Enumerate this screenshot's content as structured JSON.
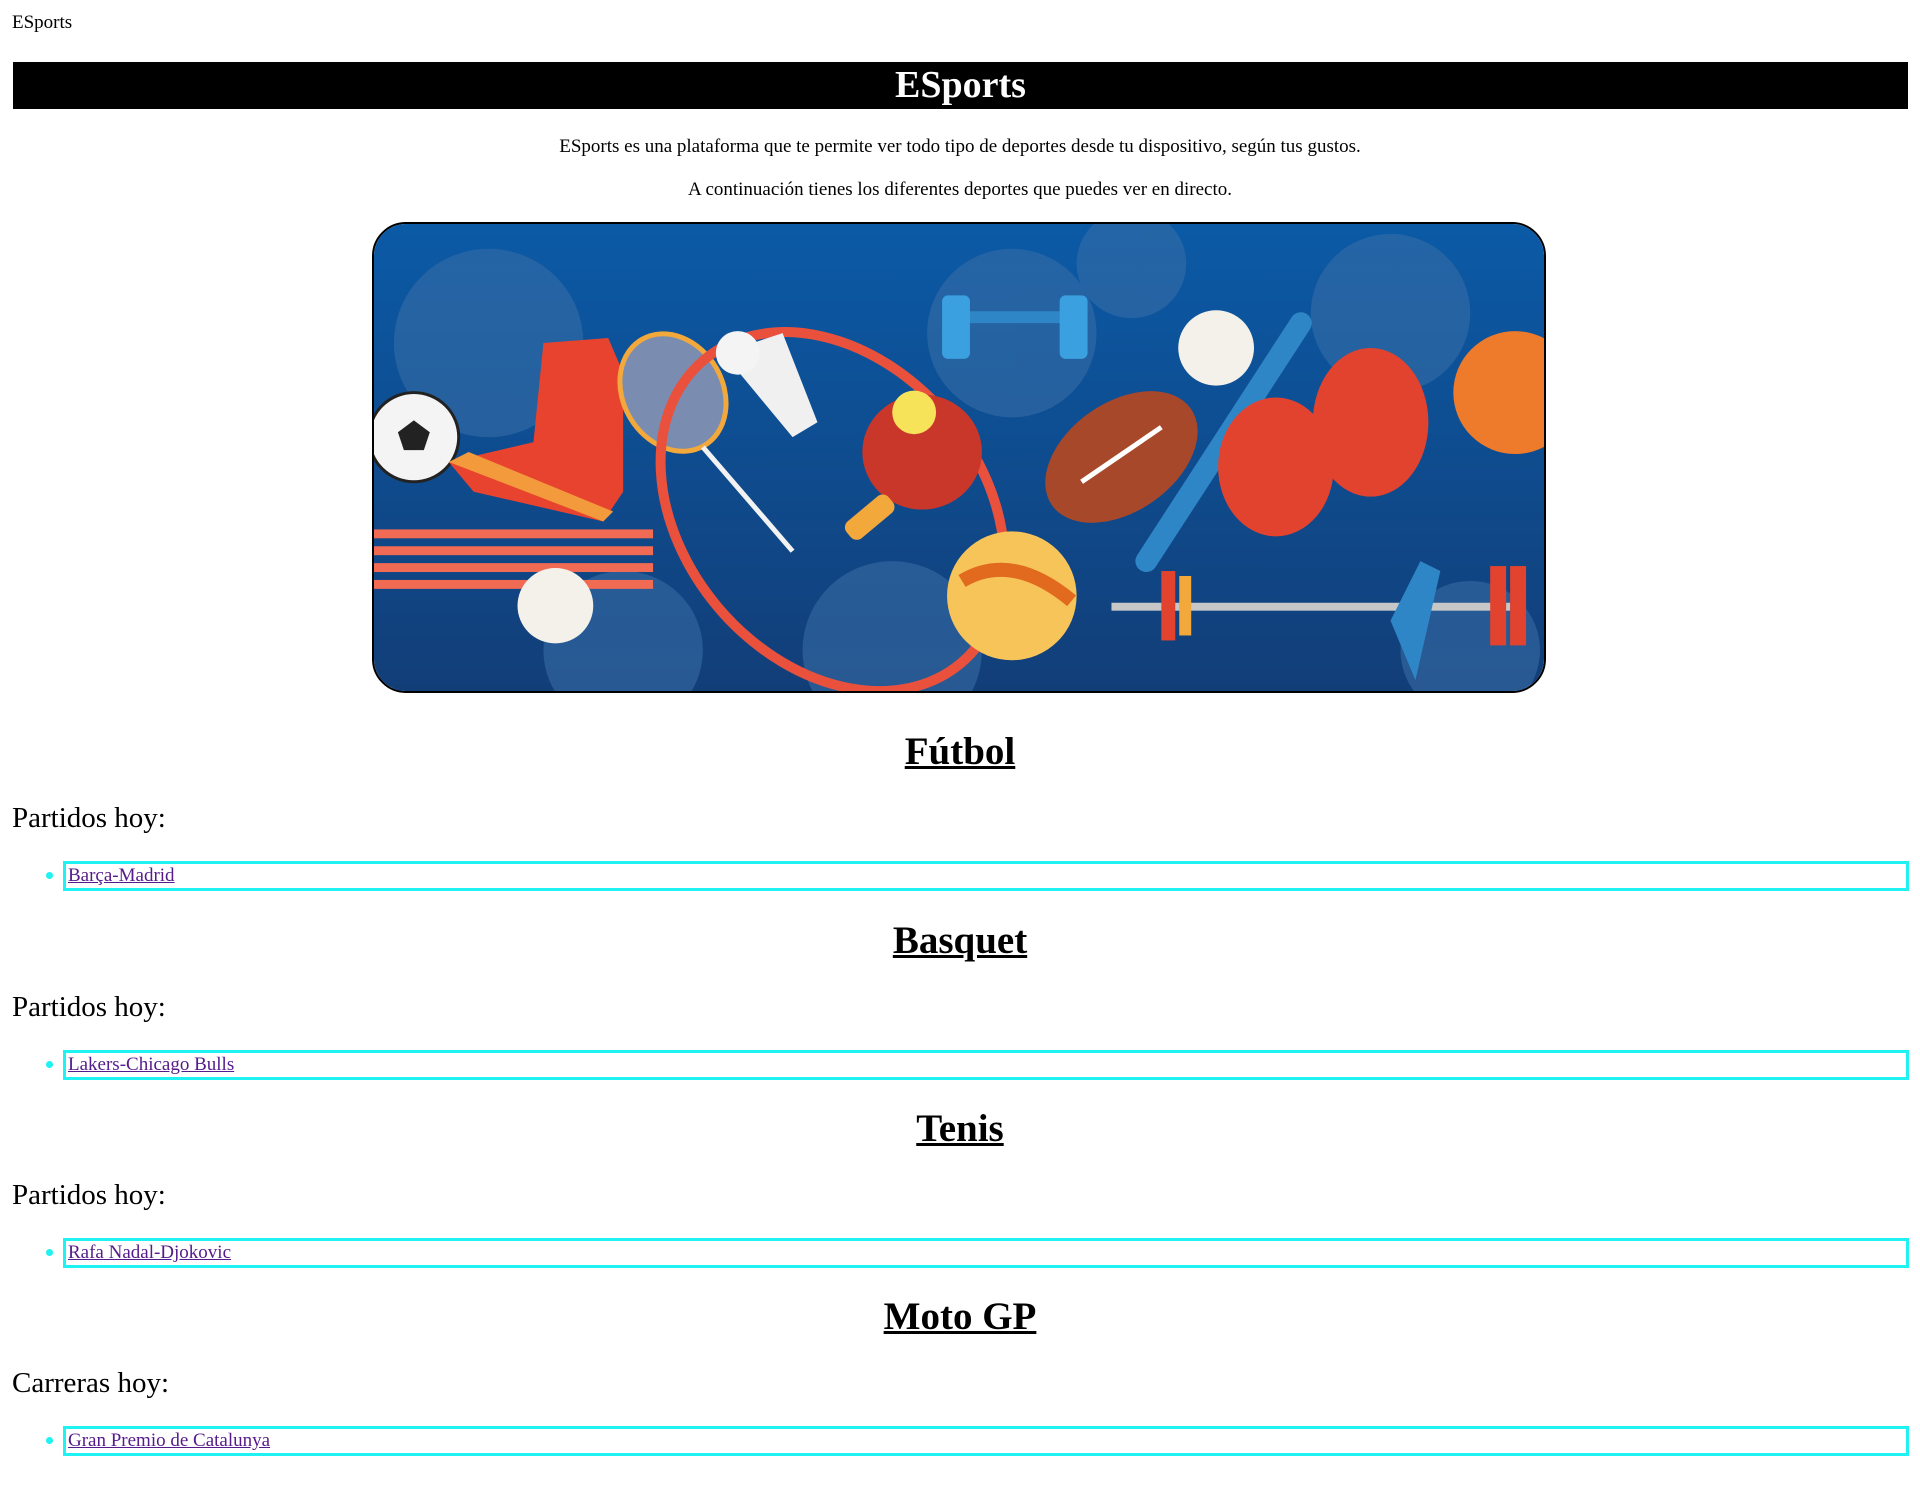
{
  "page": {
    "top_label": "ESports",
    "title": "ESports",
    "intro": [
      "ESports es una plataforma que te permite ver todo tipo de deportes desde tu dispositivo, según tus gustos.",
      "A continuación tienes los diferentes deportes que puedes ver en directo."
    ]
  },
  "banner": {
    "icon": "sports-equipment-banner",
    "background": "#0d4f91"
  },
  "sections": [
    {
      "title": "Fútbol",
      "subtitle": "Partidos hoy:",
      "link": "Barça-Madrid"
    },
    {
      "title": "Basquet",
      "subtitle": "Partidos hoy:",
      "link": "Lakers-Chicago Bulls"
    },
    {
      "title": "Tenis",
      "subtitle": "Partidos hoy:",
      "link": "Rafa Nadal-Djokovic"
    },
    {
      "title": "Moto GP",
      "subtitle": "Carreras hoy:",
      "link": "Gran Premio de Catalunya"
    }
  ],
  "colors": {
    "title_bar": "#000000",
    "focus_outline": "#1ef2f2",
    "visited_link": "#551a8b"
  }
}
